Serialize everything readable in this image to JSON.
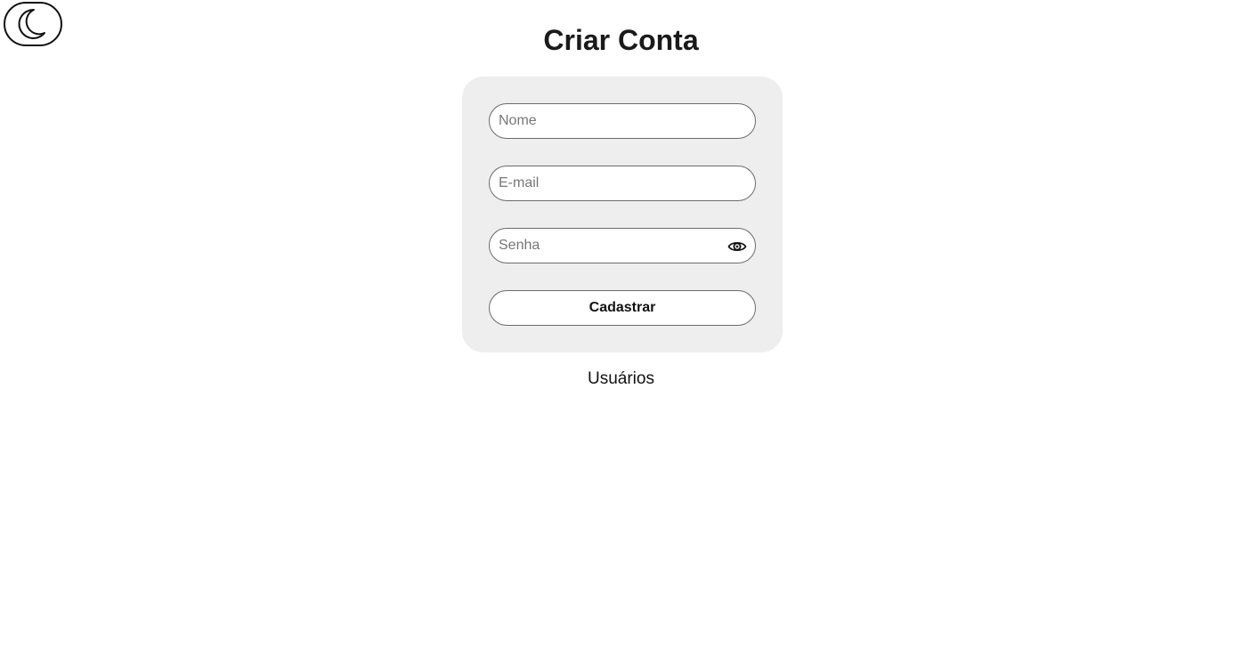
{
  "theme_toggle": {
    "icon": "moon-icon"
  },
  "page": {
    "title": "Criar Conta"
  },
  "form": {
    "name_placeholder": "Nome",
    "name_value": "",
    "email_placeholder": "E-mail",
    "email_value": "",
    "password_placeholder": "Senha",
    "password_value": "",
    "password_toggle_icon": "eye-icon",
    "submit_label": "Cadastrar"
  },
  "links": {
    "users_label": "Usuários"
  },
  "colors": {
    "card_background": "#eeeeee",
    "border": "#6b6b6b",
    "text": "#111111"
  }
}
